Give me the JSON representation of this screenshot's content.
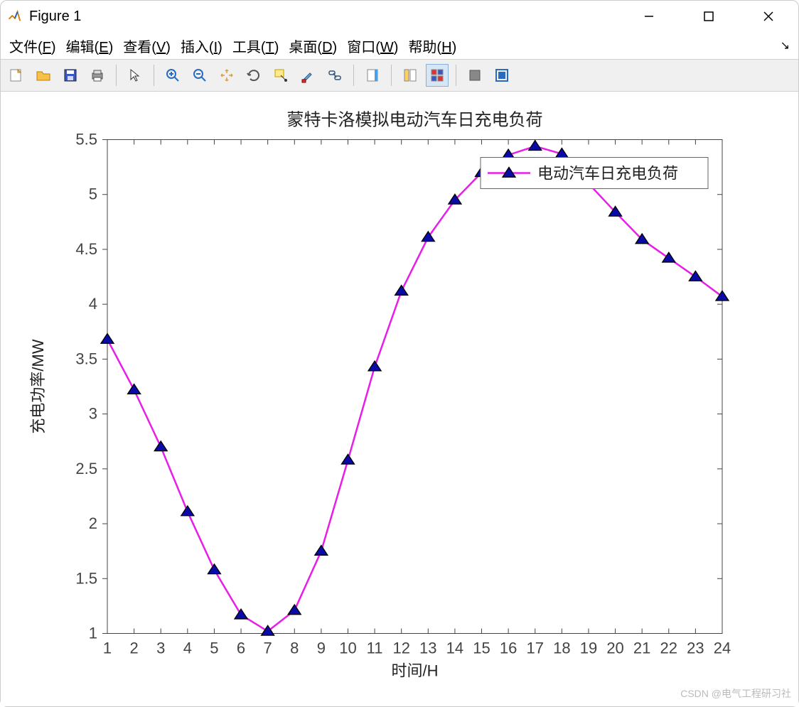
{
  "window": {
    "title": "Figure 1",
    "min_tooltip": "Minimize",
    "max_tooltip": "Maximize",
    "close_tooltip": "Close"
  },
  "menu": {
    "file": "文件(F)",
    "edit": "编辑(E)",
    "view": "查看(V)",
    "insert": "插入(I)",
    "tools": "工具(T)",
    "desktop": "桌面(D)",
    "window": "窗口(W)",
    "help": "帮助(H)"
  },
  "chart_data": {
    "type": "line",
    "title": "蒙特卡洛模拟电动汽车日充电负荷",
    "xlabel": "时间/H",
    "ylabel": "充电功率/MW",
    "xticks": [
      1,
      2,
      3,
      4,
      5,
      6,
      7,
      8,
      9,
      10,
      11,
      12,
      13,
      14,
      15,
      16,
      17,
      18,
      19,
      20,
      21,
      22,
      23,
      24
    ],
    "yticks": [
      1,
      1.5,
      2,
      2.5,
      3,
      3.5,
      4,
      4.5,
      5,
      5.5
    ],
    "ylim": [
      1,
      5.5
    ],
    "xlim": [
      1,
      24
    ],
    "legend": "电动汽车日充电负荷",
    "marker": "triangle",
    "line_color": "#e81ee8",
    "marker_face": "#0a0aa9",
    "marker_edge": "#000000",
    "x": [
      1,
      2,
      3,
      4,
      5,
      6,
      7,
      8,
      9,
      10,
      11,
      12,
      13,
      14,
      15,
      16,
      17,
      18,
      19,
      20,
      21,
      22,
      23,
      24
    ],
    "y": [
      3.68,
      3.22,
      2.7,
      2.11,
      1.58,
      1.17,
      1.02,
      1.21,
      1.75,
      2.58,
      3.43,
      4.12,
      4.61,
      4.95,
      5.2,
      5.36,
      5.44,
      5.37,
      5.1,
      4.84,
      4.59,
      4.42,
      4.25,
      4.07
    ]
  },
  "watermark": "CSDN @电气工程研习社"
}
